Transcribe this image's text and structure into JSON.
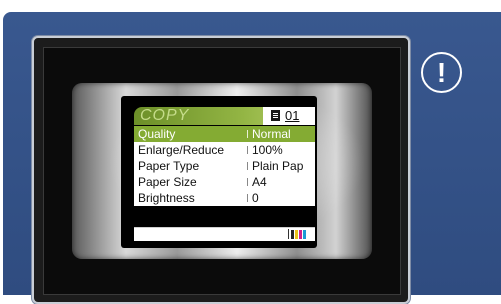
{
  "screen": {
    "mode_title": "COPY",
    "copies": "01",
    "menu": [
      {
        "label": "Quality",
        "value": "Normal",
        "selected": true
      },
      {
        "label": "Enlarge/Reduce",
        "value": "100%",
        "selected": false
      },
      {
        "label": "Paper Type",
        "value": "Plain Pap",
        "selected": false
      },
      {
        "label": "Paper Size",
        "value": "A4",
        "selected": false
      },
      {
        "label": "Brightness",
        "value": "0",
        "selected": false
      }
    ]
  },
  "alert_icon": {
    "name": "exclamation-icon",
    "glyph": "!"
  },
  "ink_colors": [
    "#222222",
    "#e8c21a",
    "#d0208a",
    "#1a9ad6"
  ],
  "colors": {
    "panel": "#39588f",
    "title_bar": "#84ab33",
    "selected_row": "#84ab33"
  }
}
